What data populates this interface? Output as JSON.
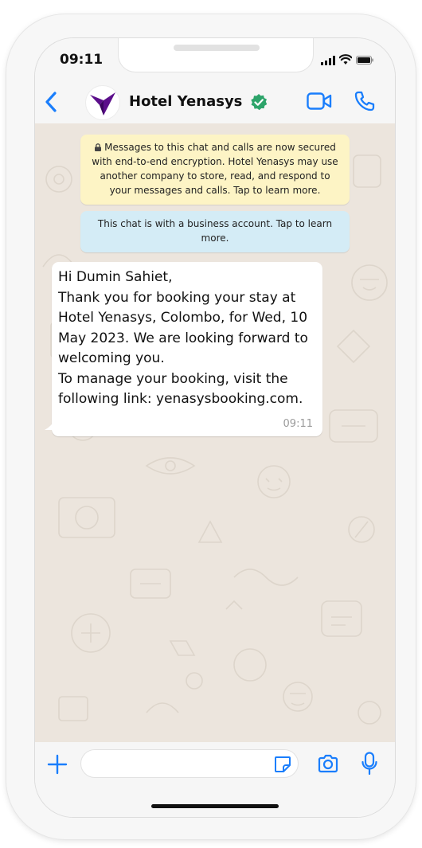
{
  "status_bar": {
    "time": "09:11"
  },
  "header": {
    "contact_name": "Hotel Yenasys",
    "verified": true,
    "accent_color": "#1a7efc",
    "logo_color": "#5c0f8b"
  },
  "chat": {
    "encryption_notice": "Messages to this chat and calls are now secured with end-to-end encryption. Hotel Yenasys may use another company to store, read, and respond to your messages and calls. Tap to learn more.",
    "business_notice": "This chat is with a business account. Tap to learn more.",
    "message": {
      "lines": [
        "Hi Dumin Sahiet,",
        "Thank you for booking your stay at Hotel Yenasys, Colombo, for Wed, 10 May 2023. We are looking forward to welcoming you.",
        "To manage your booking, visit the following link: yenasysbooking.com."
      ],
      "time": "09:11"
    },
    "colors": {
      "wallpaper": "#ece5dd",
      "encryption_bg": "#fdf4c5",
      "business_bg": "#d4ecf6",
      "bubble_bg": "#ffffff"
    }
  },
  "input": {
    "value": "",
    "placeholder": ""
  },
  "icons": {
    "back": "chevron-left-icon",
    "verified": "verified-badge-icon",
    "video": "video-call-icon",
    "call": "phone-icon",
    "attach": "plus-icon",
    "sticker": "sticker-icon",
    "camera": "camera-icon",
    "mic": "microphone-icon",
    "lock": "lock-icon"
  }
}
